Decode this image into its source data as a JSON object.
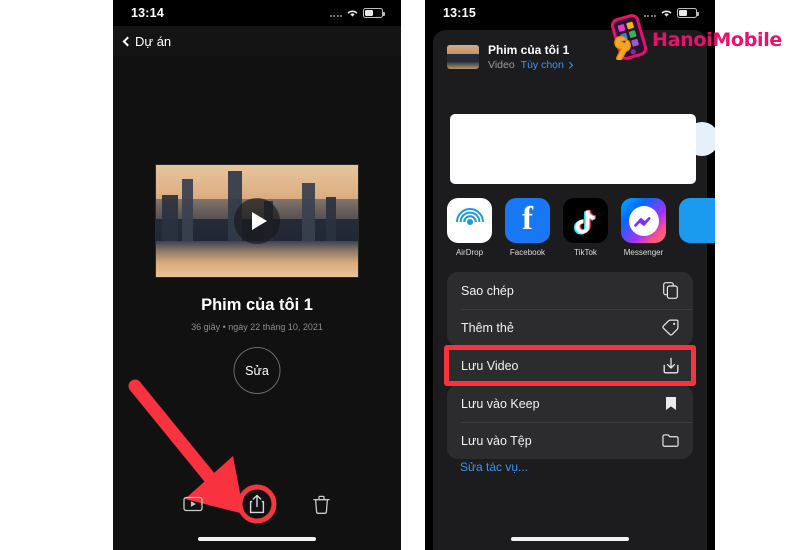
{
  "watermark": {
    "brand": "Hanoi",
    "brand2": "Mobile",
    "logo_icon": "phone-wrench-logo-icon"
  },
  "left_phone": {
    "status": {
      "time": "13:14",
      "signal_icon": "signal-dots-icon",
      "wifi_icon": "wifi-icon",
      "battery_icon": "battery-icon"
    },
    "nav": {
      "back_label": "Dự án",
      "back_icon": "chevron-left-icon"
    },
    "video": {
      "play_icon": "play-button-icon",
      "title": "Phim của tôi 1",
      "meta": "36 giây • ngày 22 tháng 10, 2021",
      "edit_label": "Sửa"
    },
    "toolbar": {
      "play_icon": "play-in-box-icon",
      "share_icon": "share-upload-icon",
      "trash_icon": "trash-icon"
    },
    "annotation": {
      "arrow_color": "#f8323f",
      "highlight_color": "#f43642"
    }
  },
  "right_phone": {
    "status": {
      "time": "13:15",
      "signal_icon": "signal-dots-icon",
      "wifi_icon": "wifi-icon",
      "battery_icon": "battery-icon"
    },
    "share_sheet": {
      "item_title": "Phim của tôi 1",
      "item_type": "Video",
      "options_label": "Tùy chọn",
      "options_chevron_icon": "chevron-right-icon",
      "apps": [
        {
          "label": "AirDrop",
          "icon": "airdrop-icon"
        },
        {
          "label": "Facebook",
          "icon": "facebook-icon"
        },
        {
          "label": "TikTok",
          "icon": "tiktok-icon"
        },
        {
          "label": "Messenger",
          "icon": "messenger-icon"
        },
        {
          "label": "",
          "icon": "more-app-icon"
        }
      ],
      "actions_group_1": [
        {
          "label": "Sao chép",
          "icon": "copy-icon"
        },
        {
          "label": "Thêm thẻ",
          "icon": "tag-icon"
        }
      ],
      "highlighted_action": {
        "label": "Lưu Video",
        "icon": "save-download-icon"
      },
      "actions_group_2": [
        {
          "label": "Lưu vào Keep",
          "icon": "bookmark-icon"
        },
        {
          "label": "Lưu vào Tệp",
          "icon": "folder-icon"
        }
      ],
      "edit_actions_label": "Sửa tác vụ..."
    }
  }
}
